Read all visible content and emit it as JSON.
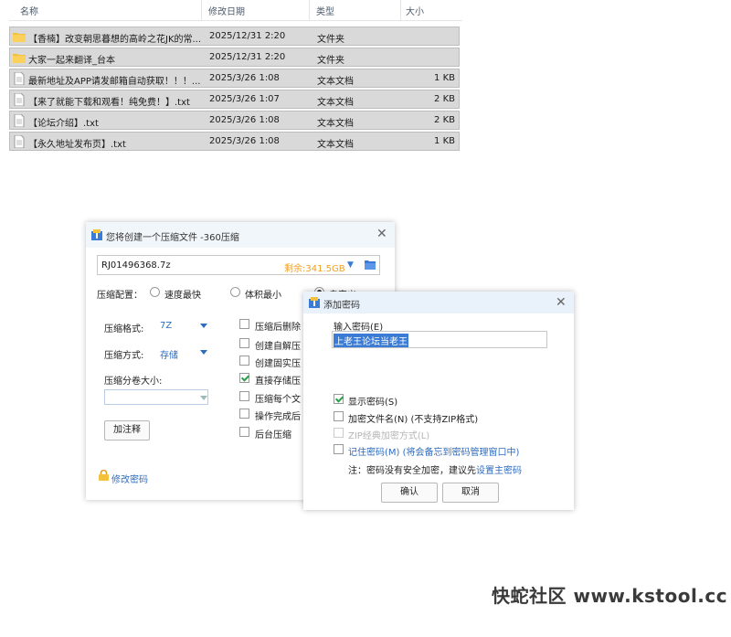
{
  "explorer": {
    "columns": {
      "name": "名称",
      "date": "修改日期",
      "type": "类型",
      "size": "大小"
    },
    "sort_indicator": "^",
    "rows": [
      {
        "icon": "folder-icon",
        "name": "【香楠】改变朝思暮想的高岭之花JK的常...",
        "date": "2025/12/31 2:20",
        "type": "文件夹",
        "size": ""
      },
      {
        "icon": "folder-icon",
        "name": "大家一起来翻译_台本",
        "date": "2025/12/31 2:20",
        "type": "文件夹",
        "size": ""
      },
      {
        "icon": "text-file-icon",
        "name": "最新地址及APP请发邮箱自动获取！！！...",
        "date": "2025/3/26 1:08",
        "type": "文本文档",
        "size": "1 KB"
      },
      {
        "icon": "text-file-icon",
        "name": "【来了就能下载和观看！纯免费！】.txt",
        "date": "2025/3/26 1:07",
        "type": "文本文档",
        "size": "2 KB"
      },
      {
        "icon": "text-file-icon",
        "name": "【论坛介绍】.txt",
        "date": "2025/3/26 1:08",
        "type": "文本文档",
        "size": "2 KB"
      },
      {
        "icon": "text-file-icon",
        "name": "【永久地址发布页】.txt",
        "date": "2025/3/26 1:08",
        "type": "文本文档",
        "size": "1 KB"
      }
    ]
  },
  "compress_dialog": {
    "title": "您将创建一个压缩文件 -360压缩",
    "path_value": "RJ01496368.7z",
    "free_space": "剩余:341.5GB",
    "config_label": "压缩配置：",
    "config_options": [
      "速度最快",
      "体积最小",
      "自定义"
    ],
    "format_label": "压缩格式:",
    "format_value": "7Z",
    "method_label": "压缩方式:",
    "method_value": "存储",
    "volume_label": "压缩分卷大小:",
    "volume_value": "",
    "options": [
      {
        "label": "压缩后删除",
        "checked": false
      },
      {
        "label": "创建自解压",
        "checked": false
      },
      {
        "label": "创建固实压",
        "checked": false
      },
      {
        "label": "直接存储压",
        "checked": true
      },
      {
        "label": "压缩每个文",
        "checked": false
      },
      {
        "label": "操作完成后",
        "checked": false
      },
      {
        "label": "后台压缩",
        "checked": false
      }
    ],
    "comment_button": "加注释",
    "change_password_link": "修改密码"
  },
  "password_dialog": {
    "title": "添加密码",
    "input_label": "输入密码(E)",
    "password_value": "上老王论坛当老王",
    "show_password": {
      "label": "显示密码(S)",
      "checked": true
    },
    "encrypt_names": {
      "label": "加密文件名(N) (不支持ZIP格式)",
      "checked": false
    },
    "zip_classic": {
      "label": "ZIP经典加密方式(L)",
      "checked": false,
      "disabled": true
    },
    "remember": {
      "label": "记住密码(M) (将会备忘到密码管理窗口中)",
      "checked": false
    },
    "note_prefix": "注：密码没有安全加密，建议先",
    "note_link": "设置主密码",
    "ok_button": "确认",
    "cancel_button": "取消"
  },
  "watermark": "快蛇社区 www.kstool.cc",
  "colors": {
    "accent": "#2d6cc0",
    "free_space": "#f0a020",
    "check": "#2aa04a",
    "row_selected": "#d9d9d9"
  }
}
